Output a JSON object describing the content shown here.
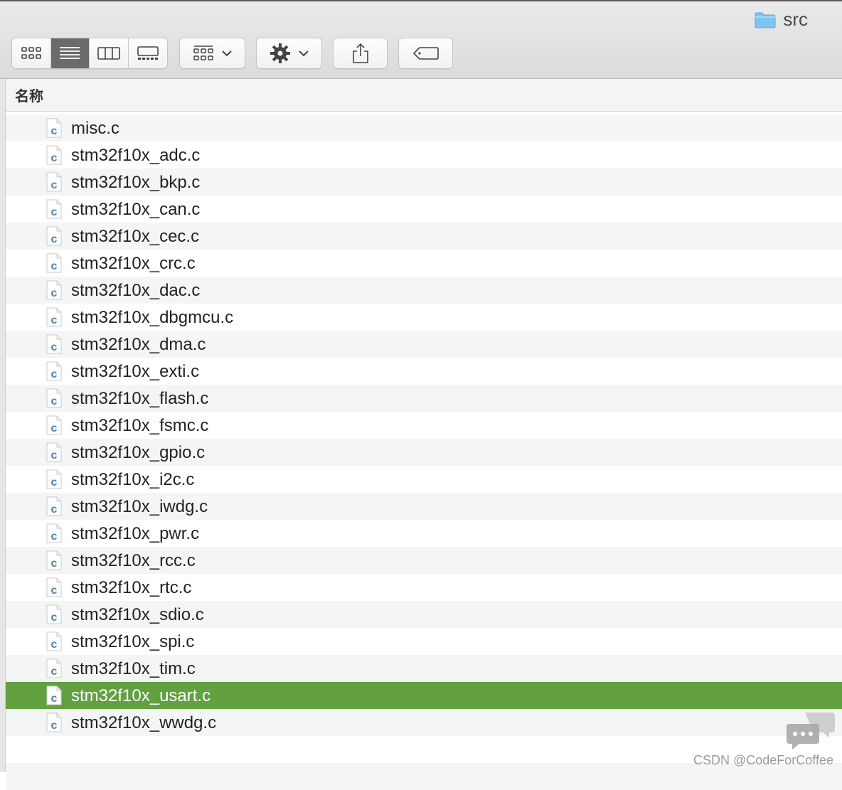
{
  "window": {
    "title": "src"
  },
  "toolbar": {
    "view_modes": [
      "icon-view-icon",
      "list-view-icon",
      "column-view-icon",
      "gallery-view-icon"
    ],
    "active_view": "list-view-icon"
  },
  "header": {
    "name_column": "名称"
  },
  "files": [
    "misc.c",
    "stm32f10x_adc.c",
    "stm32f10x_bkp.c",
    "stm32f10x_can.c",
    "stm32f10x_cec.c",
    "stm32f10x_crc.c",
    "stm32f10x_dac.c",
    "stm32f10x_dbgmcu.c",
    "stm32f10x_dma.c",
    "stm32f10x_exti.c",
    "stm32f10x_flash.c",
    "stm32f10x_fsmc.c",
    "stm32f10x_gpio.c",
    "stm32f10x_i2c.c",
    "stm32f10x_iwdg.c",
    "stm32f10x_pwr.c",
    "stm32f10x_rcc.c",
    "stm32f10x_rtc.c",
    "stm32f10x_sdio.c",
    "stm32f10x_spi.c",
    "stm32f10x_tim.c",
    "stm32f10x_usart.c",
    "stm32f10x_wwdg.c"
  ],
  "selected_file": "stm32f10x_usart.c",
  "file_icon_letter": "c",
  "colors": {
    "selection": "#62a041",
    "folder": "#7fc3ef",
    "file_icon_letter": "#4a7ea8"
  },
  "watermark": "CSDN @CodeForCoffee"
}
